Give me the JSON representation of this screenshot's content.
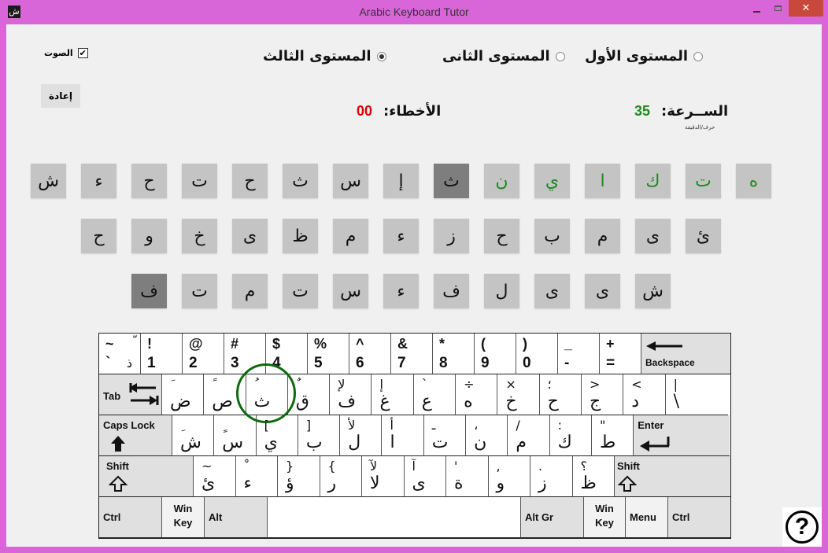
{
  "window": {
    "title": "Arabic Keyboard Tutor",
    "app_icon": "ش",
    "minimize_icon": "minimize-icon",
    "maximize_icon": "maximize-icon",
    "close_glyph": "✕"
  },
  "controls": {
    "sound_label": "الصوت",
    "sound_checked": true,
    "sound_check_glyph": "✔",
    "reset_label": "إعادة"
  },
  "levels": [
    {
      "label": "المستوى الأول",
      "checked": false
    },
    {
      "label": "المستوى الثانى",
      "checked": false
    },
    {
      "label": "المستوى الثالث",
      "checked": true
    }
  ],
  "stats": {
    "speed_label": "الســرعة:",
    "speed_value": "35",
    "speed_unit": "حرف/الدقيقة",
    "speed_color": "#1e8a1e",
    "errors_label": "الأخطاء:",
    "errors_value": "00",
    "errors_color": "#e00000"
  },
  "target_rows": [
    [
      {
        "ch": "ه",
        "state": "done"
      },
      {
        "ch": "ت",
        "state": "done"
      },
      {
        "ch": "ك",
        "state": "done"
      },
      {
        "ch": "ا",
        "state": "done"
      },
      {
        "ch": "ي",
        "state": "done"
      },
      {
        "ch": "ن",
        "state": "done"
      },
      {
        "ch": "ث",
        "state": "current"
      },
      {
        "ch": "إ",
        "state": "pending"
      },
      {
        "ch": "س",
        "state": "pending"
      },
      {
        "ch": "ث",
        "state": "pending"
      },
      {
        "ch": "ح",
        "state": "pending"
      },
      {
        "ch": "ت",
        "state": "pending"
      },
      {
        "ch": "ح",
        "state": "pending"
      },
      {
        "ch": "ء",
        "state": "pending"
      },
      {
        "ch": "ش",
        "state": "pending"
      }
    ],
    [
      {
        "ch": "ئ",
        "state": "pending"
      },
      {
        "ch": "ى",
        "state": "pending"
      },
      {
        "ch": "م",
        "state": "pending"
      },
      {
        "ch": "ب",
        "state": "pending"
      },
      {
        "ch": "ح",
        "state": "pending"
      },
      {
        "ch": "ز",
        "state": "pending"
      },
      {
        "ch": "ء",
        "state": "pending"
      },
      {
        "ch": "م",
        "state": "pending"
      },
      {
        "ch": "ظ",
        "state": "pending"
      },
      {
        "ch": "ى",
        "state": "pending"
      },
      {
        "ch": "خ",
        "state": "pending"
      },
      {
        "ch": "و",
        "state": "pending"
      },
      {
        "ch": "ح",
        "state": "pending"
      }
    ],
    [
      {
        "ch": "ش",
        "state": "pending"
      },
      {
        "ch": "ى",
        "state": "pending"
      },
      {
        "ch": "ى",
        "state": "pending"
      },
      {
        "ch": "ل",
        "state": "pending"
      },
      {
        "ch": "ف",
        "state": "pending"
      },
      {
        "ch": "ء",
        "state": "pending"
      },
      {
        "ch": "س",
        "state": "pending"
      },
      {
        "ch": "ت",
        "state": "pending"
      },
      {
        "ch": "م",
        "state": "pending"
      },
      {
        "ch": "ت",
        "state": "pending"
      },
      {
        "ch": "ف",
        "state": "current"
      }
    ]
  ],
  "keyboard": {
    "row1": [
      {
        "top": "~",
        "bot": "`",
        "ar_top": "ّ",
        "ar_bot": "ذ"
      },
      {
        "top": "!",
        "bot": "1"
      },
      {
        "top": "@",
        "bot": "2"
      },
      {
        "top": "#",
        "bot": "3"
      },
      {
        "top": "$",
        "bot": "4"
      },
      {
        "top": "%",
        "bot": "5"
      },
      {
        "top": "^",
        "bot": "6"
      },
      {
        "top": "&",
        "bot": "7"
      },
      {
        "top": "*",
        "bot": "8"
      },
      {
        "top": "(",
        "bot": "9"
      },
      {
        "top": ")",
        "bot": "0"
      },
      {
        "top": "_",
        "bot": "-"
      },
      {
        "top": "+",
        "bot": "="
      }
    ],
    "backspace_label": "Backspace",
    "tab_label": "Tab",
    "row2": [
      {
        "sym": "َ",
        "ch": "ض"
      },
      {
        "sym": "ً",
        "ch": "ص"
      },
      {
        "sym": "ُ",
        "ch": "ث"
      },
      {
        "sym": "ٌ",
        "ch": "ق"
      },
      {
        "sym": "لإ",
        "ch": "ف"
      },
      {
        "sym": "إ",
        "ch": "غ"
      },
      {
        "sym": "`",
        "ch": "ع"
      },
      {
        "sym": "÷",
        "ch": "ه"
      },
      {
        "sym": "×",
        "ch": "خ"
      },
      {
        "sym": "؛",
        "ch": "ح"
      },
      {
        "sym": ">",
        "ch": "ج"
      },
      {
        "sym": "<",
        "ch": "د"
      },
      {
        "sym": "|",
        "ch": "\\"
      }
    ],
    "caps_label": "Caps Lock",
    "row3": [
      {
        "sym": "ِ",
        "ch": "ش"
      },
      {
        "sym": "ٍ",
        "ch": "س"
      },
      {
        "sym": "[",
        "ch": "ي"
      },
      {
        "sym": "]",
        "ch": "ب"
      },
      {
        "sym": "لأ",
        "ch": "ل"
      },
      {
        "sym": "أ",
        "ch": "ا"
      },
      {
        "sym": "ـ",
        "ch": "ت"
      },
      {
        "sym": "،",
        "ch": "ن"
      },
      {
        "sym": "/",
        "ch": "م"
      },
      {
        "sym": ":",
        "ch": "ك"
      },
      {
        "sym": "\"",
        "ch": "ط"
      }
    ],
    "enter_label": "Enter",
    "shift_label": "Shift",
    "row4": [
      {
        "sym": "~",
        "ch": "ئ"
      },
      {
        "sym": "ْ",
        "ch": "ء"
      },
      {
        "sym": "}",
        "ch": "ؤ"
      },
      {
        "sym": "{",
        "ch": "ر"
      },
      {
        "sym": "لآ",
        "ch": "لا"
      },
      {
        "sym": "آ",
        "ch": "ى"
      },
      {
        "sym": "'",
        "ch": "ة"
      },
      {
        "sym": ",",
        "ch": "و"
      },
      {
        "sym": ".",
        "ch": "ز"
      },
      {
        "sym": "؟",
        "ch": "ظ"
      }
    ],
    "ctrl_label": "Ctrl",
    "win_label_1": "Win",
    "win_label_2": "Key",
    "alt_label": "Alt",
    "altgr_label": "Alt Gr",
    "menu_label": "Menu",
    "highlighted_key": "ث"
  },
  "help": {
    "glyph": "?"
  }
}
